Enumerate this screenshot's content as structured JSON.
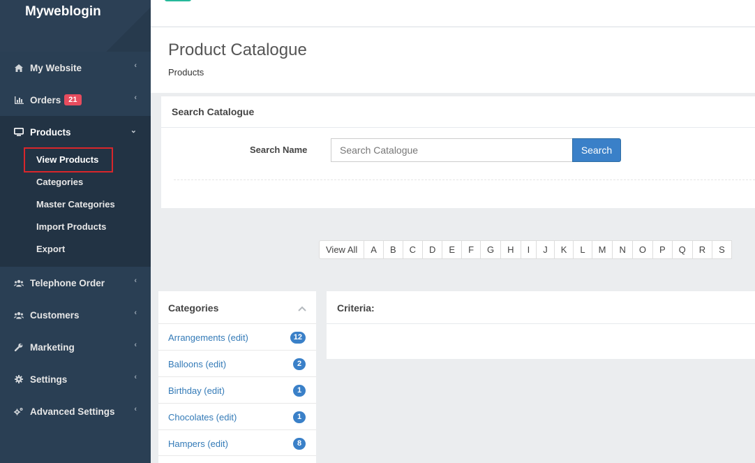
{
  "brand": "Myweblogin",
  "sidebar": {
    "items": [
      {
        "label": "My Website",
        "icon": "home-icon"
      },
      {
        "label": "Orders",
        "badge": "21",
        "icon": "bar-chart-icon"
      },
      {
        "label": "Products",
        "icon": "desktop-icon"
      },
      {
        "label": "Telephone Order",
        "icon": "users-icon"
      },
      {
        "label": "Customers",
        "icon": "users-icon"
      },
      {
        "label": "Marketing",
        "icon": "wrench-icon"
      },
      {
        "label": "Settings",
        "icon": "gear-icon"
      },
      {
        "label": "Advanced Settings",
        "icon": "gears-icon"
      }
    ],
    "products_sub": [
      "View Products",
      "Categories",
      "Master Categories",
      "Import Products",
      "Export"
    ]
  },
  "header": {
    "title": "Product Catalogue",
    "subtitle": "Products"
  },
  "search": {
    "panel_title": "Search Catalogue",
    "label": "Search Name",
    "placeholder": "Search Catalogue",
    "button": "Search"
  },
  "alphabet": [
    "View All",
    "A",
    "B",
    "C",
    "D",
    "E",
    "F",
    "G",
    "H",
    "I",
    "J",
    "K",
    "L",
    "M",
    "N",
    "O",
    "P",
    "Q",
    "R",
    "S"
  ],
  "categories": {
    "title": "Categories",
    "items": [
      {
        "name": "Arrangements (edit)",
        "count": "12"
      },
      {
        "name": "Balloons (edit)",
        "count": "2"
      },
      {
        "name": "Birthday (edit)",
        "count": "1"
      },
      {
        "name": "Chocolates (edit)",
        "count": "1"
      },
      {
        "name": "Hampers (edit)",
        "count": "8"
      }
    ]
  },
  "criteria": {
    "title": "Criteria:"
  },
  "colors": {
    "sidebar": "#2a3f54",
    "accent": "#3a80c8",
    "badge_red": "#e74c5e",
    "highlight": "#d9262b"
  }
}
